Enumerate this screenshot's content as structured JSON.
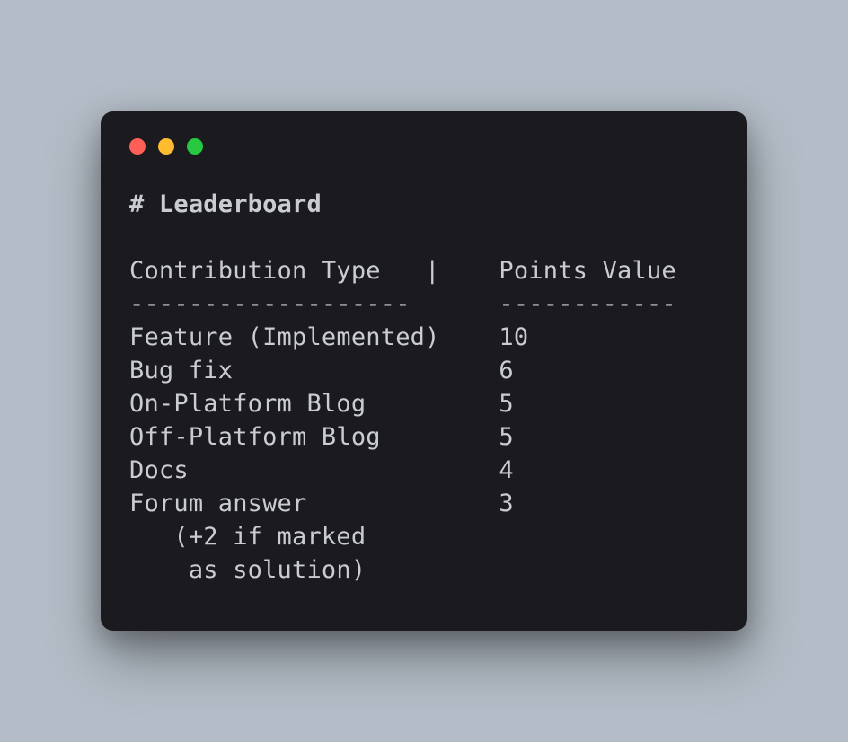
{
  "window": {
    "heading": "# Leaderboard"
  },
  "table": {
    "header_left": "Contribution Type   |",
    "header_right": "Points Value",
    "rule_left": "-------------------",
    "rule_right": "------------",
    "rows": [
      {
        "type": "Feature (Implemented)",
        "points": "10"
      },
      {
        "type": "Bug fix",
        "points": "6"
      },
      {
        "type": "On-Platform Blog",
        "points": "5"
      },
      {
        "type": "Off-Platform Blog",
        "points": "5"
      },
      {
        "type": "Docs",
        "points": "4"
      },
      {
        "type": "Forum answer",
        "points": "3"
      }
    ],
    "footnote_line1": "   (+2 if marked",
    "footnote_line2": "    as solution)"
  }
}
